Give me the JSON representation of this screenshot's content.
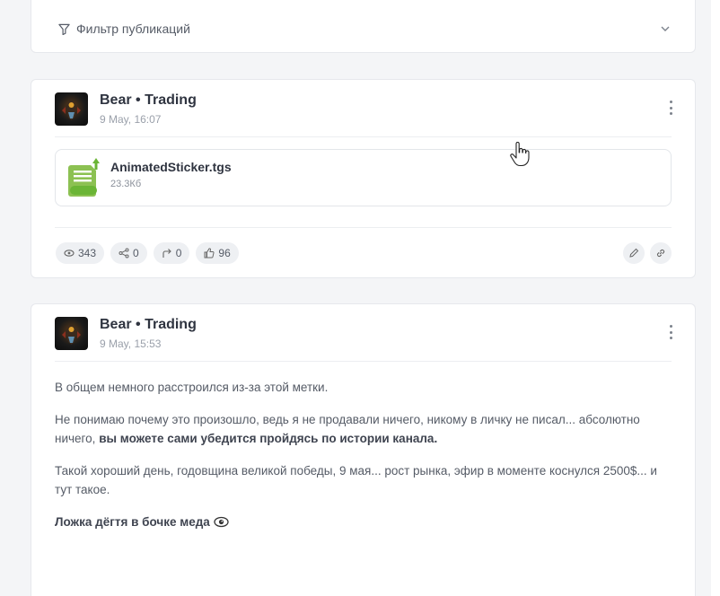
{
  "filter": {
    "label": "Фильтр публикаций",
    "icon": "filter-icon",
    "chevron": "chevron-down-icon"
  },
  "posts": [
    {
      "author": "Bear • Trading",
      "date": "9 May, 16:07",
      "file": {
        "name": "AnimatedSticker.tgs",
        "size": "23.3Кб",
        "icon": "document-icon"
      },
      "stats": {
        "views": "343",
        "shares": "0",
        "forwards": "0",
        "reactions": "96"
      }
    },
    {
      "author": "Bear • Trading",
      "date": "9 May, 15:53",
      "paragraphs": [
        "В общем немного расстроился из-за этой метки.",
        "Не понимаю почему это произошло, ведь я не продавали ничего, никому в личку не писал... абсолютно ничего, ",
        "Такой хороший день, годовщина великой победы, 9 мая... рост рынка, эфир в моменте коснулся 2500$... и тут такое."
      ],
      "bold_tail": "вы можете сами убедится пройдясь по истории канала.",
      "closing": "Ложка дёгтя в бочке меда"
    }
  ],
  "colors": {
    "accent_green": "#6bb536",
    "background": "#f4f5f7"
  }
}
